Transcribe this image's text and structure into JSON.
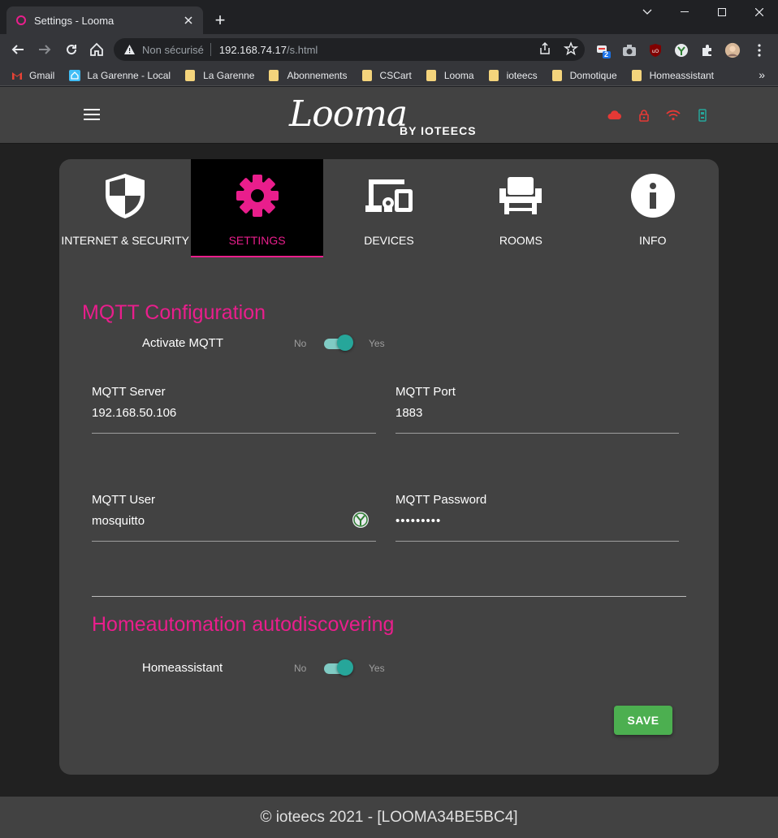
{
  "browser": {
    "tab_title": "Settings - Looma",
    "new_tab": "+",
    "security_label": "Non sécurisé",
    "url_host": "192.168.74.17",
    "url_path": "/s.html",
    "ext_badge": "2",
    "bookmarks": [
      {
        "label": "Gmail",
        "icon": "gmail-icon"
      },
      {
        "label": "La Garenne - Local",
        "icon": "home-icon"
      },
      {
        "label": "La Garenne",
        "icon": "folder-icon"
      },
      {
        "label": "Abonnements",
        "icon": "folder-icon"
      },
      {
        "label": "CSCart",
        "icon": "folder-icon"
      },
      {
        "label": "Looma",
        "icon": "folder-icon"
      },
      {
        "label": "ioteecs",
        "icon": "folder-icon"
      },
      {
        "label": "Domotique",
        "icon": "folder-icon"
      },
      {
        "label": "Homeassistant",
        "icon": "folder-icon"
      }
    ],
    "bookmarks_more": "»"
  },
  "header": {
    "logo_text": "Looma",
    "logo_by": "BY IOTEECS",
    "status_colors": {
      "cloud": "#e53935",
      "lock": "#e53935",
      "wifi": "#e53935",
      "device": "#26a69a"
    }
  },
  "tabs": [
    {
      "label": "INTERNET & SECURITY",
      "icon": "shield-icon",
      "active": false
    },
    {
      "label": "SETTINGS",
      "icon": "gear-icon",
      "active": true
    },
    {
      "label": "DEVICES",
      "icon": "devices-icon",
      "active": false
    },
    {
      "label": "ROOMS",
      "icon": "chair-icon",
      "active": false
    },
    {
      "label": "INFO",
      "icon": "info-icon",
      "active": false
    }
  ],
  "mqtt": {
    "title": "MQTT Configuration",
    "activate_label": "Activate MQTT",
    "activate_no": "No",
    "activate_yes": "Yes",
    "activate_on": true,
    "server_label": "MQTT Server",
    "server_value": "192.168.50.106",
    "port_label": "MQTT Port",
    "port_value": "1883",
    "user_label": "MQTT User",
    "user_value": "mosquitto",
    "password_label": "MQTT Password",
    "password_value": "•••••••••"
  },
  "homeautomation": {
    "title": "Homeautomation autodiscovering",
    "ha_label": "Homeassistant",
    "ha_no": "No",
    "ha_yes": "Yes",
    "ha_on": true
  },
  "save_label": "SAVE",
  "footer": "© ioteecs 2021 - [LOOMA34BE5BC4]",
  "colors": {
    "accent": "#e91e8c",
    "switch": "#26a69a",
    "save": "#4caf50"
  }
}
